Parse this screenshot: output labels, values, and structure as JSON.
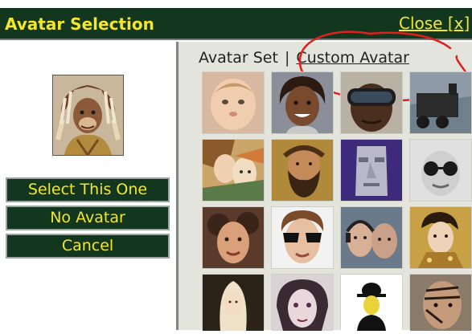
{
  "dialog": {
    "title": "Avatar Selection",
    "close_label": "Close [x]"
  },
  "left": {
    "buttons": {
      "select": "Select This One",
      "none": "No Avatar",
      "cancel": "Cancel"
    }
  },
  "right": {
    "tabs": {
      "avatar_set": "Avatar Set",
      "separator": "|",
      "custom": "Custom Avatar"
    }
  },
  "colors": {
    "titlebar_bg": "#13361f",
    "accent_text": "#f2e72b",
    "panel_bg": "#e3e5dc",
    "annotation": "#e0201f"
  }
}
